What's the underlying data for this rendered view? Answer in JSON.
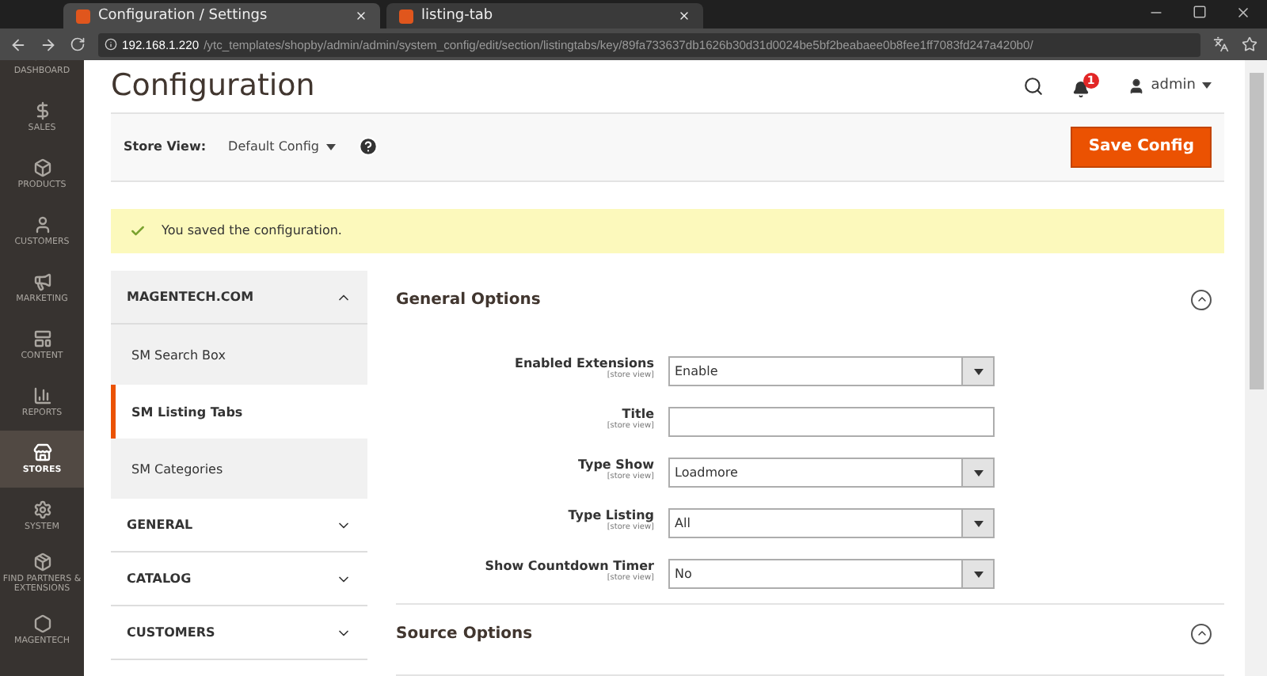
{
  "browser": {
    "tabs": [
      {
        "title": "Configuration / Settings",
        "selected": true
      },
      {
        "title": "listing-tab",
        "selected": false
      }
    ],
    "url_host": "192.168.1.220",
    "url_path": "/ytc_templates/shopby/admin/admin/system_config/edit/section/listingtabs/key/89fa733637db1626b30d31d0024be5bf2beabaee0b8fee1ff7083fd247a420b0/"
  },
  "sidebar": {
    "items": [
      {
        "label": "DASHBOARD",
        "selected": false
      },
      {
        "label": "SALES",
        "selected": false
      },
      {
        "label": "PRODUCTS",
        "selected": false
      },
      {
        "label": "CUSTOMERS",
        "selected": false
      },
      {
        "label": "MARKETING",
        "selected": false
      },
      {
        "label": "CONTENT",
        "selected": false
      },
      {
        "label": "REPORTS",
        "selected": false
      },
      {
        "label": "STORES",
        "selected": true
      },
      {
        "label": "SYSTEM",
        "selected": false
      },
      {
        "label": "FIND PARTNERS & EXTENSIONS",
        "selected": false
      },
      {
        "label": "MAGENTECH",
        "selected": false
      }
    ]
  },
  "header": {
    "title": "Configuration",
    "notifications": "1",
    "user": "admin"
  },
  "store_view": {
    "label": "Store View:",
    "value": "Default Config",
    "button": "Save Config"
  },
  "message": "You saved the configuration.",
  "config_nav": [
    {
      "title": "MAGENTECH.COM",
      "expanded": true,
      "items": [
        {
          "label": "SM Search Box",
          "selected": false
        },
        {
          "label": "SM Listing Tabs",
          "selected": true
        },
        {
          "label": "SM Categories",
          "selected": false
        }
      ]
    },
    {
      "title": "GENERAL",
      "expanded": false
    },
    {
      "title": "CATALOG",
      "expanded": false
    },
    {
      "title": "CUSTOMERS",
      "expanded": false
    }
  ],
  "sections": [
    {
      "title": "General Options",
      "expanded": true,
      "fields": [
        {
          "label": "Enabled Extensions",
          "scope": "[store view]",
          "kind": "select",
          "value": "Enable"
        },
        {
          "label": "Title",
          "scope": "[store view]",
          "kind": "text"
        },
        {
          "label": "Type Show",
          "scope": "[store view]",
          "kind": "select",
          "value": "Loadmore"
        },
        {
          "label": "Type Listing",
          "scope": "[store view]",
          "kind": "select",
          "value": "All"
        },
        {
          "label": "Show Countdown Timer",
          "scope": "[store view]",
          "kind": "select",
          "value": "No"
        }
      ]
    },
    {
      "title": "Source Options",
      "expanded": true
    }
  ]
}
